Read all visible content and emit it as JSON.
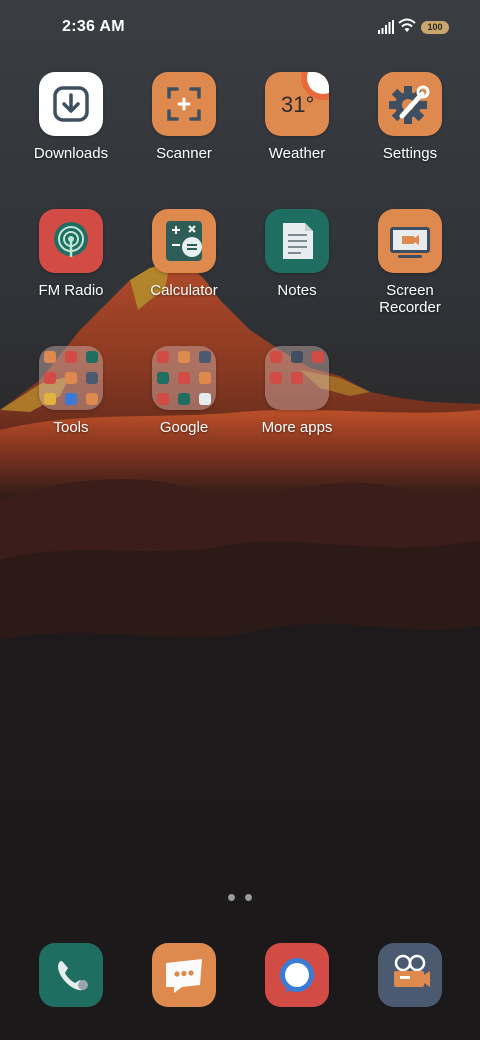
{
  "status_bar": {
    "time": "2:36 AM",
    "battery": "100",
    "icons": [
      "signal-icon",
      "wifi-icon",
      "battery-icon"
    ]
  },
  "home": {
    "row1": [
      {
        "label": "Downloads",
        "icon": "download-icon",
        "color": "#ffffff"
      },
      {
        "label": "Scanner",
        "icon": "scan-icon",
        "color": "#de8a4f"
      },
      {
        "label": "Weather",
        "icon": "weather-icon",
        "color": "#de8a4f",
        "temperature": "31°"
      },
      {
        "label": "Settings",
        "icon": "gear-icon",
        "color": "#de8a4f"
      }
    ],
    "row2": [
      {
        "label": "FM Radio",
        "icon": "radio-icon",
        "color": "#d24b45"
      },
      {
        "label": "Calculator",
        "icon": "calculator-icon",
        "color": "#de8a4f"
      },
      {
        "label": "Notes",
        "icon": "notes-icon",
        "color": "#1f6e62"
      },
      {
        "label": "Screen",
        "label_line2": "Recorder",
        "icon": "screen-recorder-icon",
        "color": "#de8a4f"
      }
    ],
    "folders": [
      {
        "label": "Tools"
      },
      {
        "label": "Google"
      },
      {
        "label": "More apps"
      }
    ]
  },
  "page_indicator": {
    "pages": 2,
    "current": 1
  },
  "dock": [
    {
      "name": "phone",
      "icon": "phone-icon",
      "color": "#1f6e62"
    },
    {
      "name": "messages",
      "icon": "message-icon",
      "color": "#de8a4f"
    },
    {
      "name": "browser",
      "icon": "browser-icon",
      "color": "#d24b45"
    },
    {
      "name": "camera",
      "icon": "camera-icon",
      "color": "#4b5a70"
    }
  ]
}
